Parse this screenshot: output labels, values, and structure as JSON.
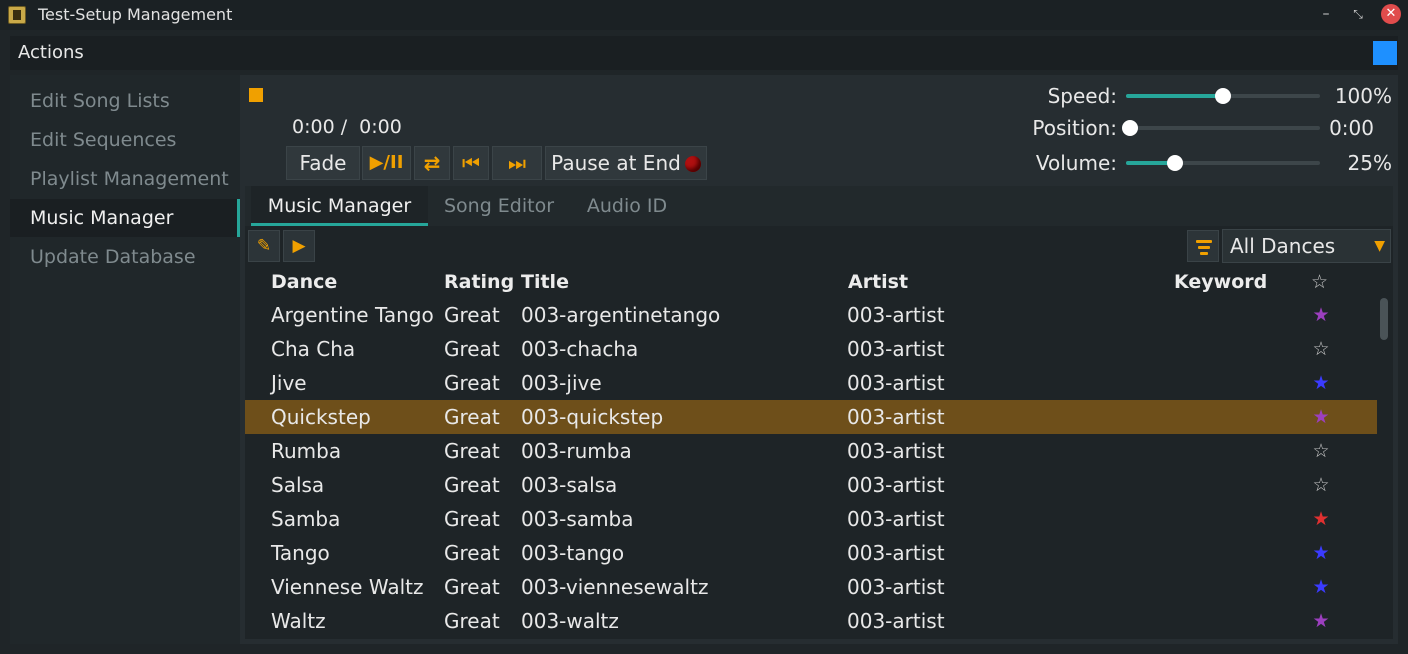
{
  "window": {
    "title": "Test-Setup Management",
    "minimize_glyph": "–",
    "restore_glyph": "⤡",
    "close_glyph": "✕"
  },
  "actions": {
    "label": "Actions",
    "square_color": "#1e90ff"
  },
  "sidebar": {
    "items": [
      {
        "label": "Edit Song Lists",
        "active": false
      },
      {
        "label": "Edit Sequences",
        "active": false
      },
      {
        "label": "Playlist Management",
        "active": false
      },
      {
        "label": "Music Manager",
        "active": true
      },
      {
        "label": "Update Database",
        "active": false
      }
    ]
  },
  "player": {
    "time_text": "0:00 /  0:00",
    "fade_label": "Fade",
    "play_pause_glyph": "▶/II",
    "repeat_glyph": "⇄",
    "previous_glyph": "⏮",
    "next_glyph": "⏭",
    "pause_at_end_label": "Pause at End",
    "speed_label": "Speed:",
    "speed_value": "100%",
    "speed_fraction": 0.5,
    "position_label": "Position:",
    "position_value": "0:00",
    "position_fraction": 0.0,
    "volume_label": "Volume:",
    "volume_value": "25%",
    "volume_fraction": 0.25
  },
  "tabs": [
    {
      "label": "Music Manager",
      "active": true
    },
    {
      "label": "Song Editor",
      "active": false
    },
    {
      "label": "Audio ID",
      "active": false
    }
  ],
  "toolbar": {
    "edit_icon": "pencil-icon",
    "play_icon": "play-icon",
    "edit_glyph": "✎",
    "play_glyph": "▶",
    "dance_filter_value": "All Dances",
    "dropdown_glyph": "▼"
  },
  "table": {
    "headers": {
      "dance": "Dance",
      "rating": "Rating",
      "title": "Title",
      "artist": "Artist",
      "keyword": "Keyword",
      "star": "☆"
    },
    "rows": [
      {
        "dance": "Argentine Tango",
        "rating": "Great",
        "title": "003-argentinetango",
        "artist": "003-artist",
        "star": "★",
        "star_color": "#9c3fbf"
      },
      {
        "dance": "Cha Cha",
        "rating": "Great",
        "title": "003-chacha",
        "artist": "003-artist",
        "star": "☆",
        "star_color": "#c8c8c8"
      },
      {
        "dance": "Jive",
        "rating": "Great",
        "title": "003-jive",
        "artist": "003-artist",
        "star": "★",
        "star_color": "#3b3bff"
      },
      {
        "dance": "Quickstep",
        "rating": "Great",
        "title": "003-quickstep",
        "artist": "003-artist",
        "star": "★",
        "star_color": "#9c3fbf"
      },
      {
        "dance": "Rumba",
        "rating": "Great",
        "title": "003-rumba",
        "artist": "003-artist",
        "star": "☆",
        "star_color": "#c8c8c8"
      },
      {
        "dance": "Salsa",
        "rating": "Great",
        "title": "003-salsa",
        "artist": "003-artist",
        "star": "☆",
        "star_color": "#c8c8c8"
      },
      {
        "dance": "Samba",
        "rating": "Great",
        "title": "003-samba",
        "artist": "003-artist",
        "star": "★",
        "star_color": "#e03030"
      },
      {
        "dance": "Tango",
        "rating": "Great",
        "title": "003-tango",
        "artist": "003-artist",
        "star": "★",
        "star_color": "#3b3bff"
      },
      {
        "dance": "Viennese Waltz",
        "rating": "Great",
        "title": "003-viennesewaltz",
        "artist": "003-artist",
        "star": "★",
        "star_color": "#3b3bff"
      },
      {
        "dance": "Waltz",
        "rating": "Great",
        "title": "003-waltz",
        "artist": "003-artist",
        "star": "★",
        "star_color": "#9c3fbf"
      }
    ],
    "selected_row": 3
  },
  "colors": {
    "accent": "#26a69a",
    "highlight": "#f0a000",
    "selection": "#6e4f1a"
  }
}
